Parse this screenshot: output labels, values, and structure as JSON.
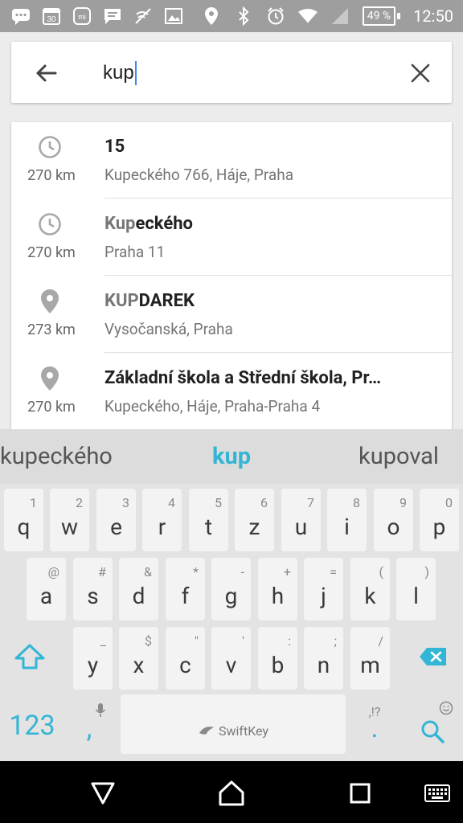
{
  "status_bar": {
    "icons": [
      "chat-bubble-icon",
      "calendar-icon",
      "mi-icon",
      "message-icon",
      "wifi-call-icon",
      "image-icon"
    ],
    "calendar_day": "30",
    "right_icons": [
      "location-icon",
      "bluetooth-icon",
      "alarm-icon",
      "wifi-icon",
      "signal-icon"
    ],
    "battery": "49 %",
    "time": "12:50"
  },
  "search": {
    "query": "kup"
  },
  "results": [
    {
      "icon": "history-icon",
      "distance": "270 km",
      "title_hl": "",
      "title_rest": "15",
      "subtitle": "Kupeckého 766, Háje, Praha"
    },
    {
      "icon": "history-icon",
      "distance": "270 km",
      "title_hl": "Kup",
      "title_rest": "eckého",
      "subtitle": "Praha 11"
    },
    {
      "icon": "place-pin-icon",
      "distance": "273 km",
      "title_hl": "KUP",
      "title_rest": "DAREK",
      "subtitle": "Vysočanská, Praha"
    },
    {
      "icon": "place-pin-icon",
      "distance": "270 km",
      "title_hl": "",
      "title_rest": "Základní škola a Střední škola, Pr…",
      "subtitle": "Kupeckého, Háje, Praha-Praha 4"
    }
  ],
  "suggestions": {
    "left": "kupeckého",
    "middle": "kup",
    "right": "kupoval"
  },
  "keyboard": {
    "row1": [
      {
        "ch": "q",
        "alt": "1"
      },
      {
        "ch": "w",
        "alt": "2"
      },
      {
        "ch": "e",
        "alt": "3"
      },
      {
        "ch": "r",
        "alt": "4"
      },
      {
        "ch": "t",
        "alt": "5"
      },
      {
        "ch": "z",
        "alt": "6"
      },
      {
        "ch": "u",
        "alt": "7"
      },
      {
        "ch": "i",
        "alt": "8"
      },
      {
        "ch": "o",
        "alt": "9"
      },
      {
        "ch": "p",
        "alt": "0"
      }
    ],
    "row2": [
      {
        "ch": "a",
        "alt": "@"
      },
      {
        "ch": "s",
        "alt": "#"
      },
      {
        "ch": "d",
        "alt": "&"
      },
      {
        "ch": "f",
        "alt": "*"
      },
      {
        "ch": "g",
        "alt": "-"
      },
      {
        "ch": "h",
        "alt": "+"
      },
      {
        "ch": "j",
        "alt": "="
      },
      {
        "ch": "k",
        "alt": "("
      },
      {
        "ch": "l",
        "alt": ")"
      }
    ],
    "row3": [
      {
        "ch": "y",
        "alt": "_"
      },
      {
        "ch": "x",
        "alt": "$"
      },
      {
        "ch": "c",
        "alt": "\""
      },
      {
        "ch": "v",
        "alt": "'"
      },
      {
        "ch": "b",
        "alt": ":"
      },
      {
        "ch": "n",
        "alt": ";"
      },
      {
        "ch": "m",
        "alt": "/"
      }
    ],
    "num_label": "123",
    "comma": ",",
    "space_label": "SwiftKey",
    "period_alt": ",!?",
    "period": "."
  },
  "colors": {
    "accent": "#33b5d6",
    "caret": "#4285f4"
  }
}
